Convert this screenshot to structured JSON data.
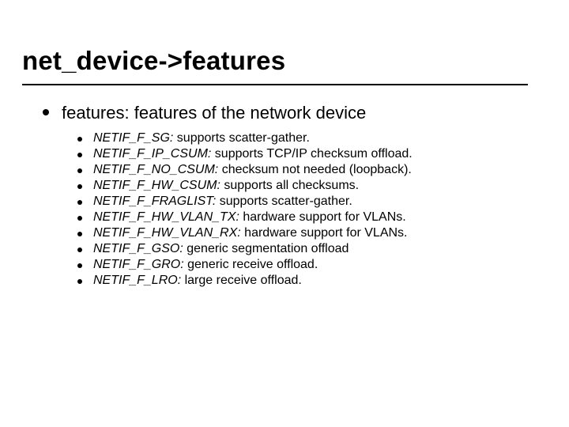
{
  "title": "net_device->features",
  "intro": "features: features of the network device",
  "flags": [
    {
      "name": "NETIF_F_SG:",
      "desc": " supports scatter-gather."
    },
    {
      "name": "NETIF_F_IP_CSUM:",
      "desc": " supports TCP/IP checksum offload."
    },
    {
      "name": "NETIF_F_NO_CSUM:",
      "desc": " checksum not needed (loopback)."
    },
    {
      "name": "NETIF_F_HW_CSUM:",
      "desc": " supports all checksums."
    },
    {
      "name": "NETIF_F_FRAGLIST:",
      "desc": " supports scatter-gather."
    },
    {
      "name": "NETIF_F_HW_VLAN_TX:",
      "desc": " hardware support for VLANs."
    },
    {
      "name": "NETIF_F_HW_VLAN_RX:",
      "desc": " hardware support for VLANs."
    },
    {
      "name": "NETIF_F_GSO:",
      "desc": " generic segmentation offload"
    },
    {
      "name": "NETIF_F_GRO:",
      "desc": " generic receive offload."
    },
    {
      "name": "NETIF_F_LRO:",
      "desc": " large receive offload."
    }
  ]
}
